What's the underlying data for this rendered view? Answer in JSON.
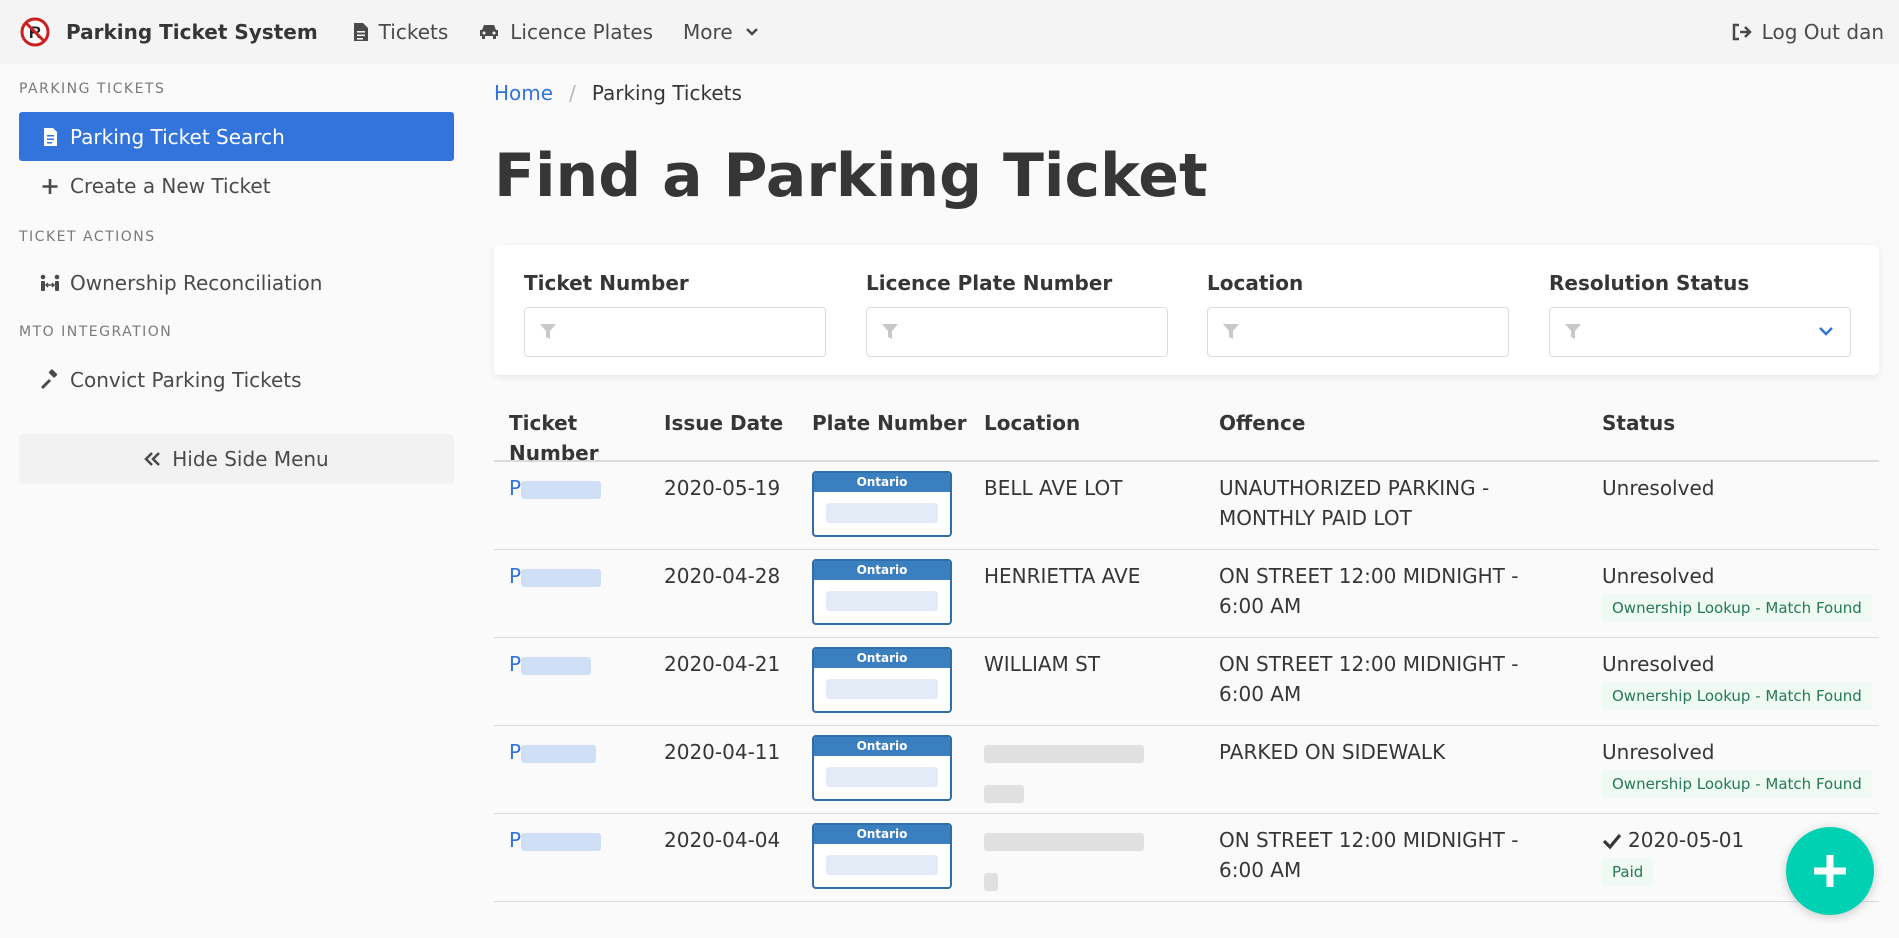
{
  "header": {
    "app_title": "Parking Ticket System",
    "nav": {
      "tickets": "Tickets",
      "licence_plates": "Licence Plates",
      "more": "More",
      "logout": "Log Out dan"
    }
  },
  "sidebar": {
    "sections": [
      {
        "label": "PARKING TICKETS",
        "items": [
          "Parking Ticket Search",
          "Create a New Ticket"
        ]
      },
      {
        "label": "TICKET ACTIONS",
        "items": [
          "Ownership Reconciliation"
        ]
      },
      {
        "label": "MTO INTEGRATION",
        "items": [
          "Convict Parking Tickets"
        ]
      }
    ],
    "hide_menu": "Hide Side Menu"
  },
  "breadcrumb": {
    "home": "Home",
    "sep": "/",
    "current": "Parking Tickets"
  },
  "page_title": "Find a Parking Ticket",
  "filters": {
    "ticket_number": "Ticket Number",
    "plate_number": "Licence Plate Number",
    "location": "Location",
    "resolution_status": "Resolution Status"
  },
  "table": {
    "headers": [
      "Ticket Number",
      "Issue Date",
      "Plate Number",
      "Location",
      "Offence",
      "Status"
    ],
    "plate_province": "Ontario",
    "rows": [
      {
        "ticket_prefix": "P",
        "date": "2020-05-19",
        "location": "BELL AVE LOT",
        "offence": "UNAUTHORIZED PARKING - MONTHLY PAID LOT",
        "status": "Unresolved",
        "tag": ""
      },
      {
        "ticket_prefix": "P",
        "date": "2020-04-28",
        "location": "HENRIETTA AVE",
        "offence": "ON STREET 12:00 MIDNIGHT - 6:00 AM",
        "status": "Unresolved",
        "tag": "Ownership Lookup - Match Found"
      },
      {
        "ticket_prefix": "P",
        "date": "2020-04-21",
        "location": "WILLIAM ST",
        "offence": "ON STREET 12:00 MIDNIGHT - 6:00 AM",
        "status": "Unresolved",
        "tag": "Ownership Lookup - Match Found"
      },
      {
        "ticket_prefix": "P",
        "date": "2020-04-11",
        "location": "",
        "offence": "PARKED ON SIDEWALK",
        "status": "Unresolved",
        "tag": "Ownership Lookup - Match Found"
      },
      {
        "ticket_prefix": "P",
        "date": "2020-04-04",
        "location": "",
        "offence": "ON STREET 12:00 MIDNIGHT - 6:00 AM",
        "status": "2020-05-01",
        "tag": "Paid"
      }
    ]
  },
  "colors": {
    "primary": "#3273dc",
    "fab": "#00d1b2",
    "tag_bg": "#effaf5",
    "tag_text": "#257953"
  }
}
